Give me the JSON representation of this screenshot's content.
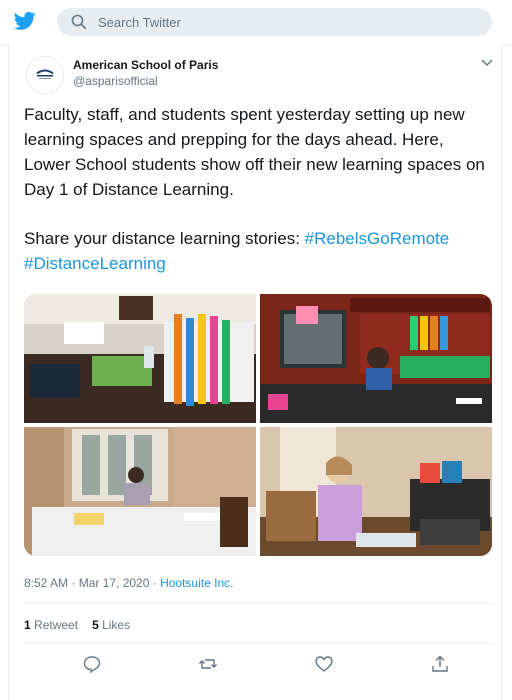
{
  "header": {
    "logo_icon": "twitter-bird-icon",
    "search_placeholder": "Search Twitter",
    "search_icon": "search-icon",
    "accent_color": "#1da1f2"
  },
  "tweet": {
    "author_name": "American School of Paris",
    "author_handle": "@asparisofficial",
    "text_paragraph_1": "Faculty, staff, and students spent yesterday setting up new learning spaces  and prepping for the days ahead. Here, Lower School students show off their new learning spaces on Day 1 of Distance Learning.",
    "text_paragraph_2_lead": "Share your distance learning stories: ",
    "hashtag_1": "#RebelsGoRemote",
    "hashtag_2": "#DistanceLearning",
    "hashtag_color": "#1b95e0",
    "timestamp": "8:52 AM · Mar 17, 2020 · ",
    "source": "Hootsuite Inc.",
    "retweet_count": "1",
    "retweet_label": "Retweet",
    "like_count": "5",
    "like_label": "Likes"
  },
  "actions": [
    {
      "icon": "reply-icon"
    },
    {
      "icon": "retweet-icon"
    },
    {
      "icon": "like-heart-icon"
    },
    {
      "icon": "share-icon"
    }
  ]
}
